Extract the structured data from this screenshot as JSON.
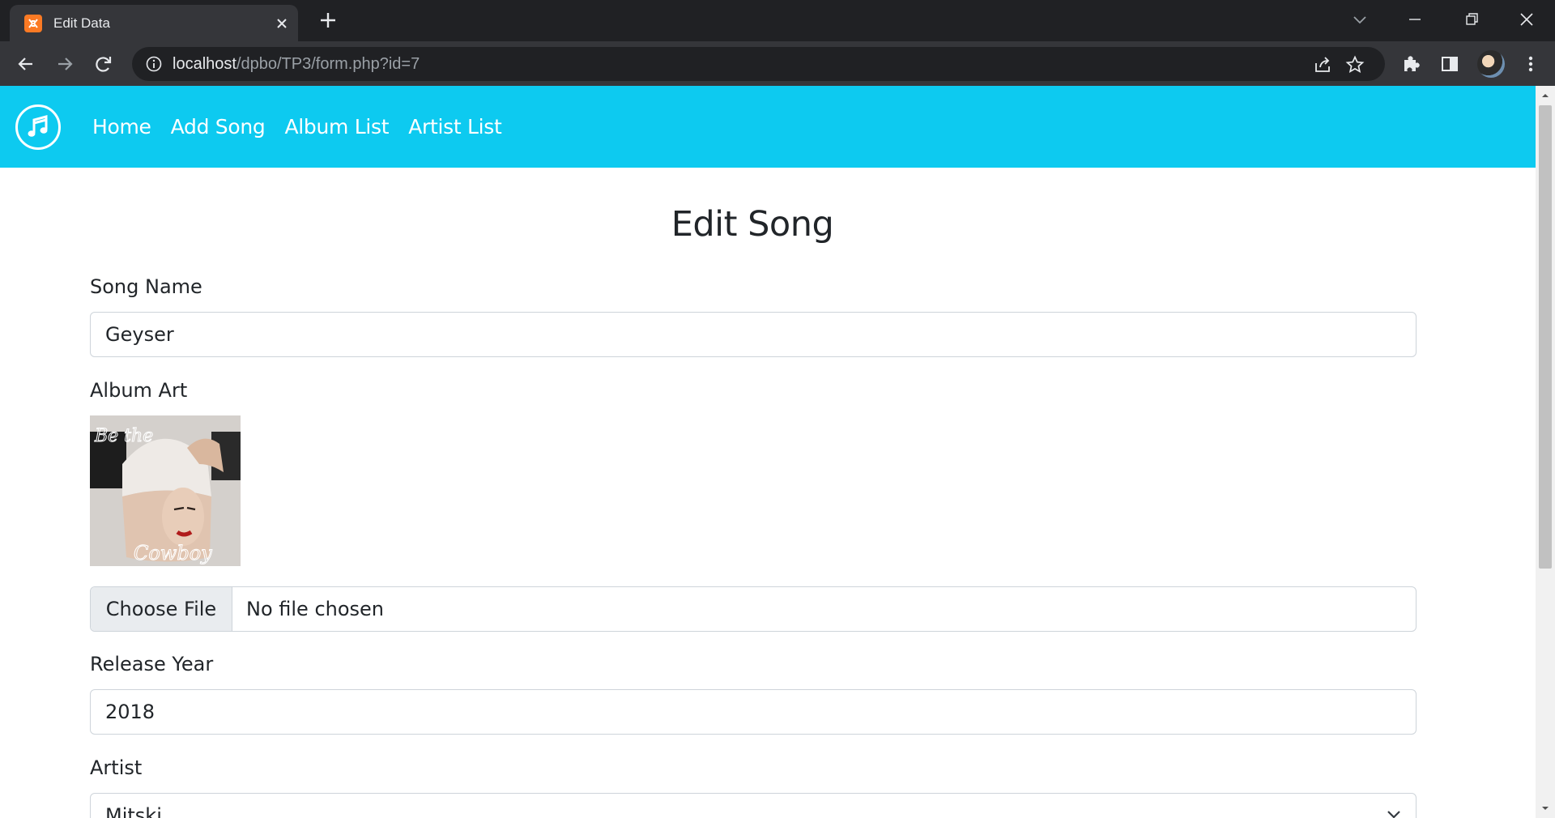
{
  "browser": {
    "tab_title": "Edit Data",
    "url_host": "localhost",
    "url_path": "/dpbo/TP3/form.php?id=7"
  },
  "navbar": {
    "links": [
      "Home",
      "Add Song",
      "Album List",
      "Artist List"
    ]
  },
  "page": {
    "title": "Edit Song"
  },
  "form": {
    "song_name_label": "Song Name",
    "song_name_value": "Geyser",
    "album_art_label": "Album Art",
    "album_art_overlay_lines": [
      "Be the",
      "Cowboy"
    ],
    "file_button_label": "Choose File",
    "file_status": "No file chosen",
    "release_year_label": "Release Year",
    "release_year_value": "2018",
    "artist_label": "Artist",
    "artist_value": "Mitski"
  },
  "colors": {
    "navbar": "#0dcaf0",
    "chrome_dark": "#202124",
    "chrome_toolbar": "#35363a"
  },
  "icons": {
    "favicon": "xampp-icon",
    "brand": "music-note-icon"
  }
}
